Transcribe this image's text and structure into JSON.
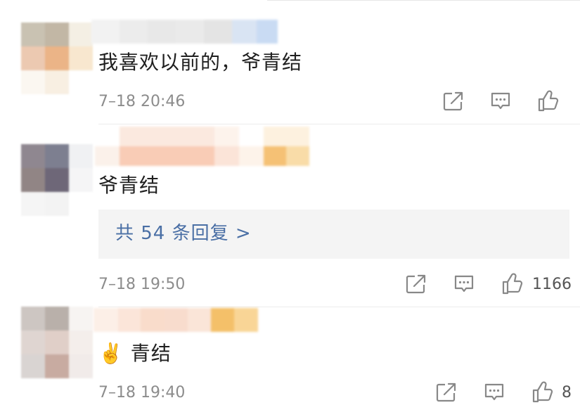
{
  "comments": [
    {
      "text": "我喜欢以前的，爷青结",
      "time": "7–18 20:46",
      "like_count": ""
    },
    {
      "text": "爷青结",
      "time": "7–18 19:50",
      "replies_label": "共 54 条回复 >",
      "like_count": "1166"
    },
    {
      "text": "✌️ 青结",
      "time": "7–18 19:40",
      "like_count": "8"
    }
  ],
  "icons": {
    "share": "share-icon",
    "comment": "comment-icon",
    "like": "thumbs-up-icon"
  },
  "colors": {
    "link": "#4a6fa5",
    "timestamp": "#8c8c8c",
    "reply_background": "#f4f4f4"
  }
}
